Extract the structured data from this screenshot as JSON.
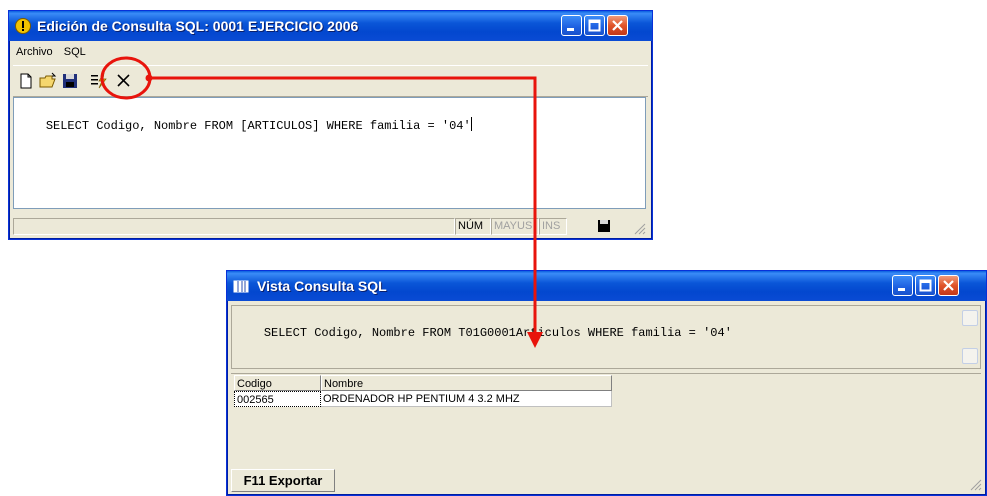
{
  "window1": {
    "title": "Edición de Consulta SQL: 0001 EJERCICIO 2006",
    "menu": [
      "Archivo",
      "SQL"
    ],
    "sql_text": "SELECT Codigo, Nombre FROM [ARTICULOS] WHERE familia = '04'",
    "status": {
      "num": "NÚM",
      "mayus": "MAYUS",
      "ins": "INS"
    }
  },
  "window2": {
    "title": "Vista Consulta SQL",
    "sql_text": "SELECT Codigo, Nombre FROM T01G0001Articulos WHERE familia = '04'",
    "grid": {
      "columns": [
        "Codigo",
        "Nombre"
      ],
      "rows": [
        [
          "002565",
          "ORDENADOR HP PENTIUM 4 3.2 MHZ"
        ]
      ]
    },
    "export_button": "F11 Exportar"
  },
  "icons": [
    "new-file-icon",
    "open-folder-icon",
    "save-icon",
    "execute-sql-icon",
    "delete-icon",
    "minimize-icon",
    "maximize-icon",
    "close-icon"
  ],
  "colors": {
    "titlebar": "#0a56d8",
    "highlight": "#e8140c",
    "window_bg": "#ece9d8"
  }
}
